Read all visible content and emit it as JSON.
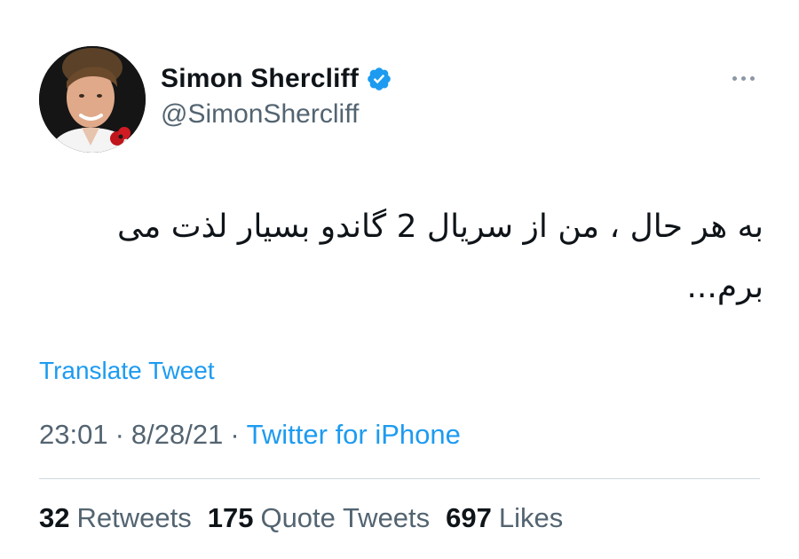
{
  "author": {
    "display_name": "Simon Shercliff",
    "handle": "@SimonShercliff",
    "verified": true
  },
  "tweet": {
    "text": "به هر حال ، من از سریال 2 گاندو بسیار لذت می برم...",
    "translate_label": "Translate Tweet",
    "time": "23:01",
    "date": "8/28/21",
    "separator": "·",
    "source": "Twitter for iPhone"
  },
  "stats": {
    "retweets_count": "32",
    "retweets_label": "Retweets",
    "quotes_count": "175",
    "quotes_label": "Quote Tweets",
    "likes_count": "697",
    "likes_label": "Likes"
  },
  "colors": {
    "accent": "#1d9bf0",
    "text_primary": "#0f1419",
    "text_secondary": "#536471",
    "divider": "#cfd9de"
  },
  "icons": {
    "verified": "verified-badge-icon",
    "more": "more-horizontal-icon"
  }
}
